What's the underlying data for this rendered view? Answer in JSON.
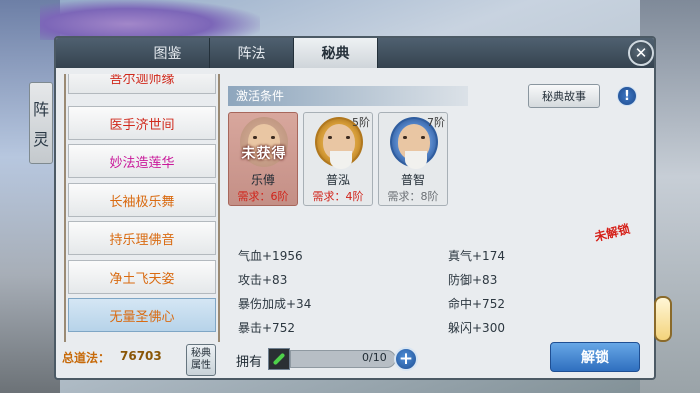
{
  "side_tab": {
    "chars": [
      "阵",
      "灵"
    ]
  },
  "tabs": [
    {
      "label": "图鉴",
      "active": false
    },
    {
      "label": "阵法",
      "active": false
    },
    {
      "label": "秘典",
      "active": true
    }
  ],
  "close_icon": "close-icon",
  "list": [
    {
      "label": "菩尔迦师缘",
      "color": "#d02a1d",
      "selected": false
    },
    {
      "label": "医手济世间",
      "color": "#d02a1d",
      "selected": false
    },
    {
      "label": "妙法造莲华",
      "color": "#c9199a",
      "selected": false
    },
    {
      "label": "长袖极乐舞",
      "color": "#d96b12",
      "selected": false
    },
    {
      "label": "持乐理佛音",
      "color": "#d96b12",
      "selected": false
    },
    {
      "label": "净土飞天姿",
      "color": "#d96b12",
      "selected": false
    },
    {
      "label": "无量圣佛心",
      "color": "#d96b12",
      "selected": true
    }
  ],
  "total": {
    "label": "总道法：",
    "value": "76703"
  },
  "attr_button": {
    "line1": "秘典",
    "line2": "属性"
  },
  "conditions": {
    "title": "激活条件",
    "story_button": "秘典故事",
    "info_icon": "!",
    "cards": [
      {
        "name": "乐僔",
        "requirement": "需求：6阶",
        "tier": "",
        "stamp": "未获得",
        "active": true,
        "req_color": "#d1231a"
      },
      {
        "name": "普泓",
        "requirement": "需求：4阶",
        "tier": "5阶",
        "stamp": "",
        "active": false,
        "req_color": "#d1231a"
      },
      {
        "name": "普智",
        "requirement": "需求：8阶",
        "tier": "7阶",
        "stamp": "",
        "active": false,
        "req_color": "#6b7075"
      }
    ],
    "locked_stamp": "未解锁"
  },
  "stats": [
    {
      "label": "气血+1956"
    },
    {
      "label": "真气+174"
    },
    {
      "label": "攻击+83"
    },
    {
      "label": "防御+83"
    },
    {
      "label": "暴伤加成+34"
    },
    {
      "label": "命中+752"
    },
    {
      "label": "暴击+752"
    },
    {
      "label": "躲闪+300"
    }
  ],
  "own": {
    "label": "拥有",
    "count": "0/10",
    "progress": 0.0,
    "plus": "+"
  },
  "unlock_button": "解锁"
}
